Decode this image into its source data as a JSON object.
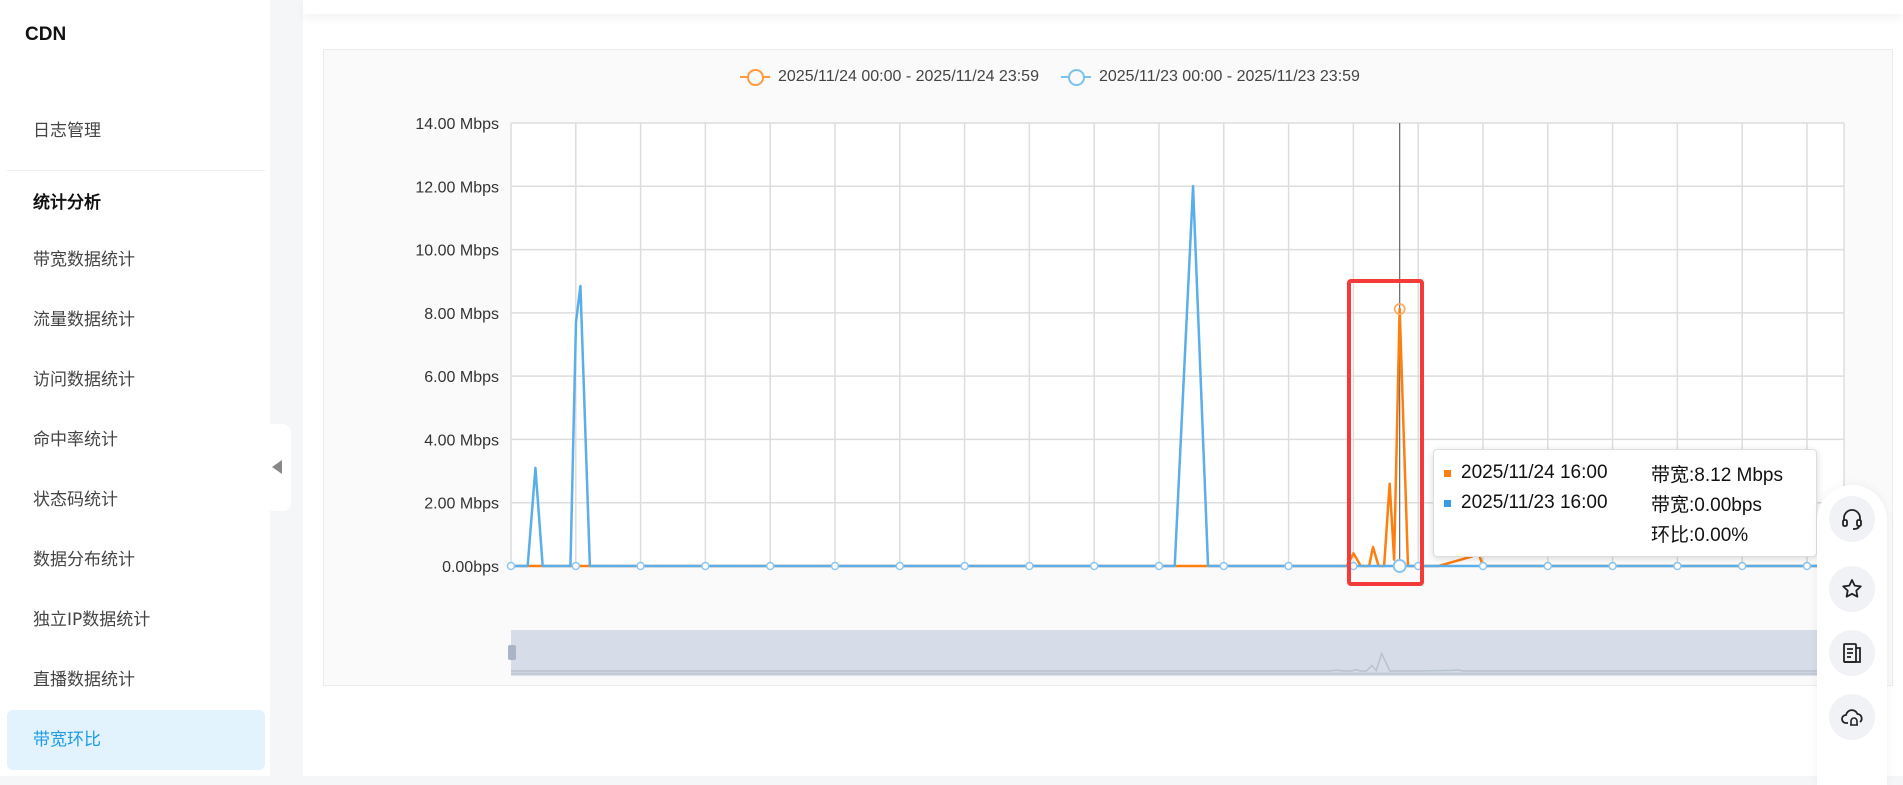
{
  "sidebar": {
    "brand": "CDN",
    "log_item": "日志管理",
    "group": "统计分析",
    "items": [
      "带宽数据统计",
      "流量数据统计",
      "访问数据统计",
      "命中率统计",
      "状态码统计",
      "数据分布统计",
      "独立IP数据统计",
      "直播数据统计",
      "带宽环比"
    ],
    "active_index": 8
  },
  "chart_data": {
    "type": "line",
    "title": "",
    "xlabel": "",
    "ylabel": "",
    "x_unit": "hour of day",
    "xlim": [
      0,
      24
    ],
    "ylim": [
      0,
      14
    ],
    "yticks": [
      0,
      2,
      4,
      6,
      8,
      10,
      12,
      14
    ],
    "ytick_labels": [
      "0.00bps",
      "2.00 Mbps",
      "4.00 Mbps",
      "6.00 Mbps",
      "8.00 Mbps",
      "10.00 Mbps",
      "12.00 Mbps",
      "14.00 Mbps"
    ],
    "grid": true,
    "legend_position": "top-center",
    "series": [
      {
        "name": "2025/11/24 00:00 - 2025/11/24 23:59",
        "color": "#ff7f0e",
        "points": [
          [
            0,
            0
          ],
          [
            15.05,
            0
          ],
          [
            15.17,
            0.4
          ],
          [
            15.3,
            0
          ],
          [
            15.45,
            0
          ],
          [
            15.52,
            0.6
          ],
          [
            15.62,
            0
          ],
          [
            15.72,
            0
          ],
          [
            15.82,
            2.6
          ],
          [
            15.9,
            0.2
          ],
          [
            16.0,
            8.12
          ],
          [
            16.15,
            0
          ],
          [
            16.7,
            0
          ],
          [
            16.9,
            0.1
          ],
          [
            17.1,
            0.2
          ],
          [
            17.3,
            0.3
          ],
          [
            17.4,
            0.5
          ],
          [
            17.5,
            0
          ],
          [
            24,
            0
          ]
        ]
      },
      {
        "name": "2025/11/23 00:00 - 2025/11/23 23:59",
        "color": "#5aaeea",
        "points": [
          [
            0,
            0
          ],
          [
            0.3,
            0
          ],
          [
            0.44,
            3.1
          ],
          [
            0.57,
            0
          ],
          [
            1.07,
            0
          ],
          [
            1.17,
            7.7
          ],
          [
            1.25,
            8.85
          ],
          [
            1.42,
            0
          ],
          [
            11.95,
            0
          ],
          [
            12.28,
            12.0
          ],
          [
            12.55,
            0
          ],
          [
            24,
            0
          ]
        ]
      }
    ],
    "hover_x": 16.0
  },
  "tooltip": {
    "rows": [
      {
        "date": "2025/11/24 16:00",
        "value": "带宽:8.12 Mbps",
        "color": "#ff7f0e"
      },
      {
        "date": "2025/11/23 16:00",
        "value": "带宽:0.00bps",
        "color": "#3a9be8"
      }
    ],
    "ratio": "环比:0.00%"
  },
  "float_buttons": [
    "headset-icon",
    "star-icon",
    "document-icon",
    "cloud-bell-icon"
  ]
}
